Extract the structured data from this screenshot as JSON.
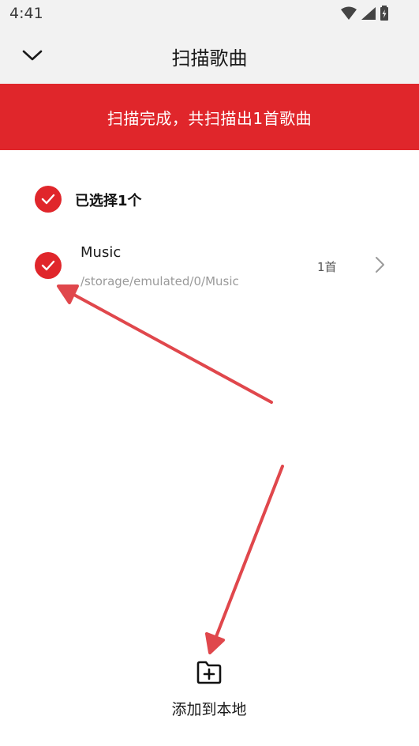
{
  "status_bar": {
    "time": "4:41",
    "icons": [
      "wifi-icon",
      "signal-icon",
      "battery-icon"
    ]
  },
  "header": {
    "title": "扫描歌曲",
    "back_icon": "chevron-down-icon"
  },
  "banner": {
    "text": "扫描完成，共扫描出1首歌曲",
    "color": "#e0262b"
  },
  "selection": {
    "label": "已选择1个",
    "checked": true
  },
  "folders": [
    {
      "name": "Music",
      "path": "/storage/emulated/0/Music",
      "count": "1首",
      "checked": true
    }
  ],
  "footer": {
    "add_label": "添加到本地",
    "add_icon": "folder-add-icon"
  },
  "colors": {
    "accent": "#e0262b",
    "annotation_arrow": "#e0474c"
  }
}
